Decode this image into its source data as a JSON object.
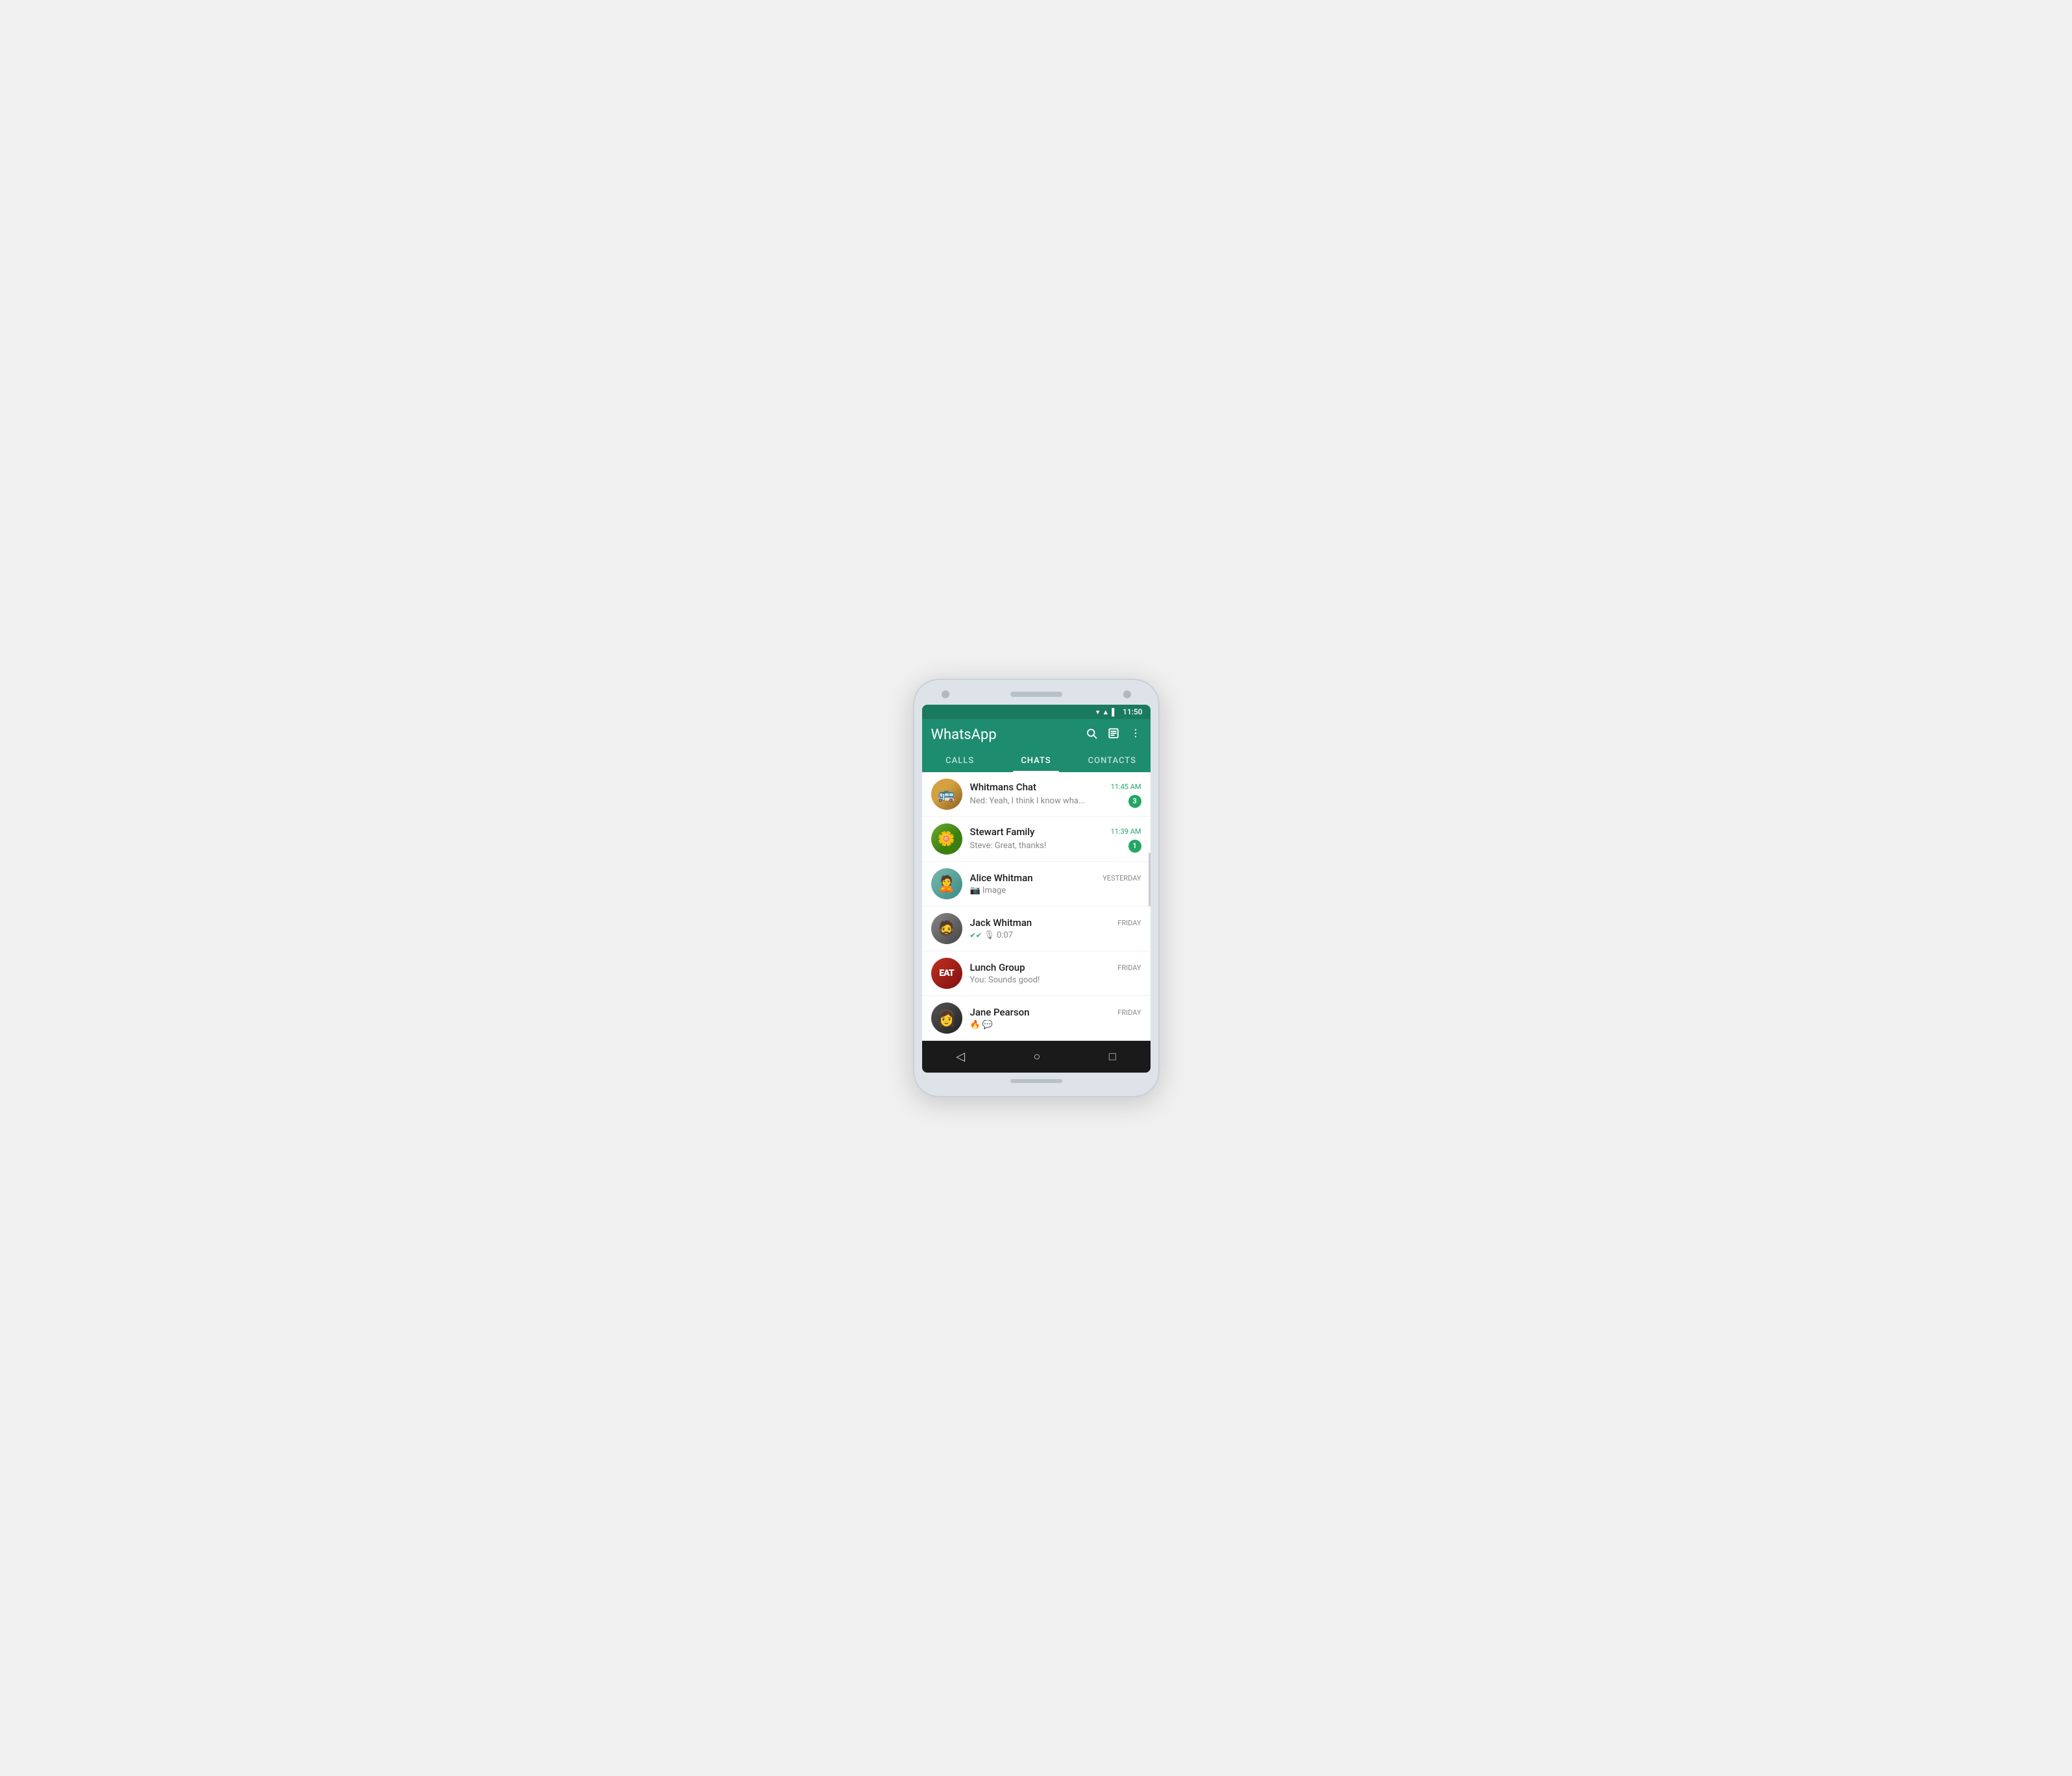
{
  "phone": {
    "statusBar": {
      "time": "11:50",
      "wifiIcon": "▼",
      "signalIcon": "▲",
      "batteryIcon": "🔋"
    },
    "header": {
      "title": "WhatsApp",
      "searchIcon": "search",
      "editIcon": "edit",
      "moreIcon": "more"
    },
    "tabs": [
      {
        "id": "calls",
        "label": "CALLS",
        "active": false
      },
      {
        "id": "chats",
        "label": "CHATS",
        "active": true
      },
      {
        "id": "contacts",
        "label": "CONTACTS",
        "active": false
      }
    ],
    "chats": [
      {
        "id": "whitmans",
        "name": "Whitmans Chat",
        "time": "11:45 AM",
        "timeGreen": true,
        "preview": "Ned: Yeah, I think I know wha...",
        "unread": 3,
        "avatarEmoji": "🚌",
        "avatarClass": "avatar-whitmans-bg avatar-bus"
      },
      {
        "id": "stewart",
        "name": "Stewart Family",
        "time": "11:39 AM",
        "timeGreen": true,
        "preview": "Steve: Great, thanks!",
        "unread": 1,
        "avatarEmoji": "🌼",
        "avatarClass": "avatar-flowers"
      },
      {
        "id": "alice",
        "name": "Alice Whitman",
        "time": "YESTERDAY",
        "timeGreen": false,
        "preview": "📷 Image",
        "unread": 0,
        "avatarEmoji": "👤",
        "avatarClass": "avatar-alice-bg"
      },
      {
        "id": "jack",
        "name": "Jack Whitman",
        "time": "FRIDAY",
        "timeGreen": false,
        "preview": "✔✔ 🎙 0:07",
        "unread": 0,
        "avatarEmoji": "🧔",
        "avatarClass": "avatar-jack-bg"
      },
      {
        "id": "lunch",
        "name": "Lunch Group",
        "time": "FRIDAY",
        "timeGreen": false,
        "preview": "You: Sounds good!",
        "unread": 0,
        "avatarText": "EAT",
        "avatarClass": "avatar-eat-bg"
      },
      {
        "id": "jane",
        "name": "Jane Pearson",
        "time": "FRIDAY",
        "timeGreen": false,
        "preview": "🔥 💬",
        "unread": 0,
        "avatarEmoji": "👩",
        "avatarClass": "avatar-jane-bg"
      }
    ],
    "navBar": {
      "backIcon": "◁",
      "homeIcon": "○",
      "recentIcon": "□"
    }
  }
}
